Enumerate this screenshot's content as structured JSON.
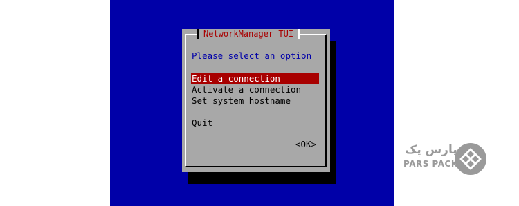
{
  "dialog": {
    "title": "NetworkManager TUI",
    "prompt": "Please select an option",
    "menu_items": [
      {
        "label": "Edit a connection",
        "selected": true
      },
      {
        "label": "Activate a connection",
        "selected": false
      },
      {
        "label": "Set system hostname",
        "selected": false
      }
    ],
    "quit_label": "Quit",
    "ok_label": "<OK>"
  },
  "watermark": {
    "brand_fa": "پارس پک",
    "brand_en": "PARS PACK",
    "icon": "parspack-logo-icon"
  },
  "colors": {
    "terminal_bg": "#0000a8",
    "dialog_bg": "#a8a8a8",
    "title_text": "#a80000",
    "prompt_text": "#0000a8",
    "selection_bg": "#a80000",
    "selection_text": "#ffffff",
    "logo_gray": "#9a9a9a"
  }
}
